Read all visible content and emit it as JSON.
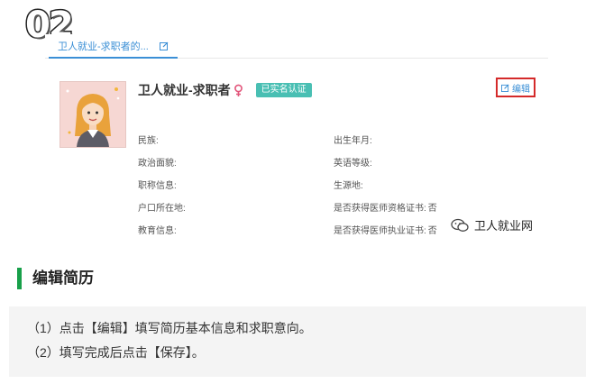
{
  "step_number": "02",
  "tab": {
    "label": "卫人就业-求职者的..."
  },
  "profile": {
    "name": "卫人就业-求职者",
    "verified_badge": "已实名认证",
    "edit_label": "编辑"
  },
  "fields_left": [
    {
      "label": "民族:",
      "value": ""
    },
    {
      "label": "政治面貌:",
      "value": ""
    },
    {
      "label": "职称信息:",
      "value": ""
    },
    {
      "label": "户口所在地:",
      "value": ""
    },
    {
      "label": "教育信息:",
      "value": ""
    }
  ],
  "fields_right": [
    {
      "label": "出生年月:",
      "value": ""
    },
    {
      "label": "英语等级:",
      "value": ""
    },
    {
      "label": "生源地:",
      "value": ""
    },
    {
      "label": "是否获得医师资格证书:",
      "value": "否"
    },
    {
      "label": "是否获得医师执业证书:",
      "value": "否"
    }
  ],
  "watermark": {
    "text": "卫人就业网"
  },
  "section": {
    "title": "编辑简历"
  },
  "instructions": [
    "（1）点击【编辑】填写简历基本信息和求职意向。",
    "（2）填写完成后点击【保存】。"
  ],
  "colors": {
    "accent_blue": "#3b8fd6",
    "badge_teal": "#49bfb3",
    "highlight_red": "#d42a2a",
    "section_green": "#18a04a",
    "female_pink": "#e2557a"
  }
}
